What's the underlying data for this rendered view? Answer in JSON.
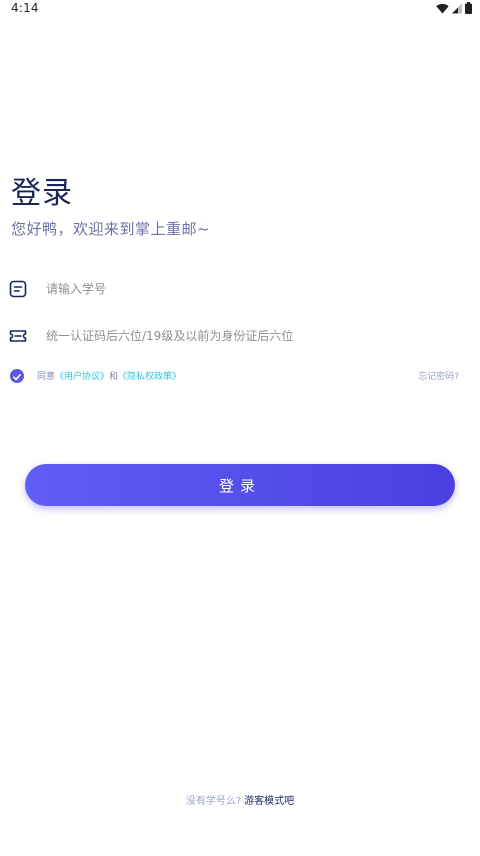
{
  "status_bar": {
    "time": "4:14",
    "icons": [
      "wifi-icon",
      "signal-icon",
      "battery-icon"
    ]
  },
  "header": {
    "title": "登录",
    "subtitle": "您好鸭，欢迎来到掌上重邮~"
  },
  "form": {
    "student_id": {
      "icon": "id-card-icon",
      "placeholder": "请输入学号",
      "value": ""
    },
    "password": {
      "icon": "ticket-icon",
      "placeholder": "统一认证码后六位/19级及以前为身份证后六位",
      "value": ""
    }
  },
  "agreement": {
    "checked": true,
    "prefix": "同意",
    "user_agreement": "《用户协议》",
    "conjunction": "和",
    "privacy_policy": "《隐私权政策》",
    "forgot_password": "忘记密码?"
  },
  "login_button": {
    "label": "登录"
  },
  "guest": {
    "prompt": "没有学号么?",
    "link": "游客模式吧"
  },
  "colors": {
    "title": "#1b2559",
    "accent_start": "#5f5ef6",
    "accent_end": "#4a3fe0",
    "link": "#2cc7e0",
    "muted": "#97a3c2"
  }
}
